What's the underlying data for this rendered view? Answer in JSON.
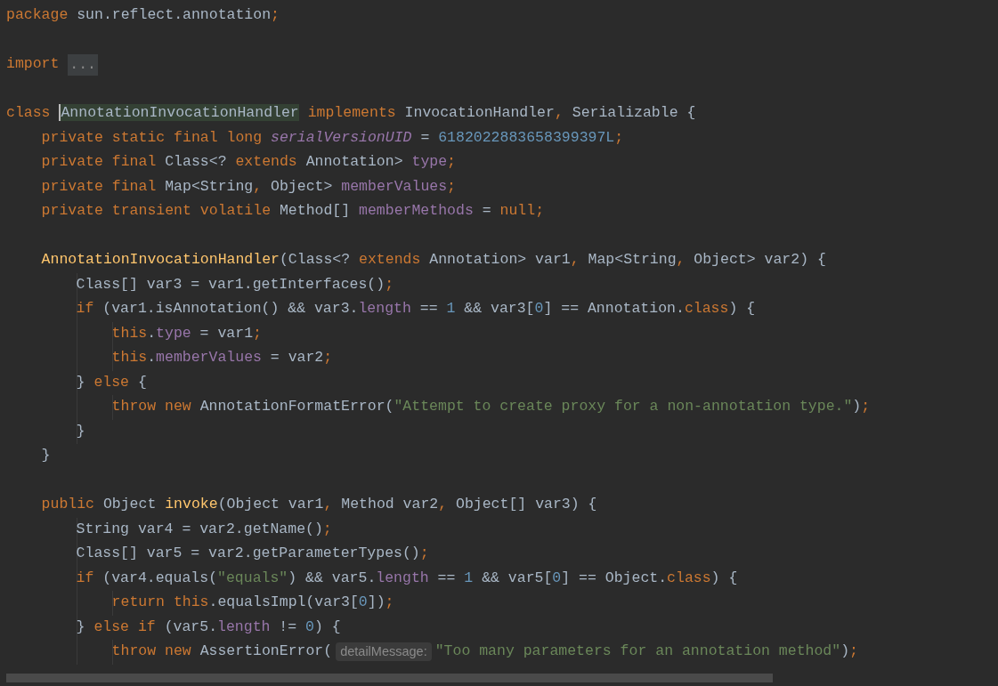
{
  "lines": [
    {
      "kind": "code",
      "tokens": [
        {
          "text": "package",
          "kind": "kw"
        },
        {
          "text": " sun.reflect.annotation",
          "kind": "plain"
        },
        {
          "text": ";",
          "kind": "kw"
        }
      ]
    },
    {
      "kind": "blank"
    },
    {
      "kind": "code",
      "tokens": [
        {
          "text": "import ",
          "kind": "kw"
        },
        {
          "text": "...",
          "kind": "fold"
        }
      ]
    },
    {
      "kind": "blank"
    },
    {
      "kind": "code",
      "tokens": [
        {
          "text": "class ",
          "kind": "kw"
        },
        {
          "text": "AnnotationInvocationHandler",
          "kind": "ref"
        },
        {
          "text": " implements ",
          "kind": "kw"
        },
        {
          "text": "InvocationHandler",
          "kind": "plain"
        },
        {
          "text": ",",
          "kind": "kw"
        },
        {
          "text": " Serializable {",
          "kind": "plain"
        }
      ],
      "children": [
        {
          "kind": "code",
          "tokens": [
            {
              "text": "private static final long ",
              "kind": "kw"
            },
            {
              "text": "serialVersionUID",
              "kind": "sfield"
            },
            {
              "text": " = ",
              "kind": "plain"
            },
            {
              "text": "6182022883658399397L",
              "kind": "num"
            },
            {
              "text": ";",
              "kind": "kw"
            }
          ]
        },
        {
          "kind": "code",
          "tokens": [
            {
              "text": "private final ",
              "kind": "kw"
            },
            {
              "text": "Class<? ",
              "kind": "plain"
            },
            {
              "text": "extends ",
              "kind": "kw"
            },
            {
              "text": "Annotation> ",
              "kind": "plain"
            },
            {
              "text": "type",
              "kind": "field"
            },
            {
              "text": ";",
              "kind": "kw"
            }
          ]
        },
        {
          "kind": "code",
          "tokens": [
            {
              "text": "private final ",
              "kind": "kw"
            },
            {
              "text": "Map<String",
              "kind": "plain"
            },
            {
              "text": ",",
              "kind": "kw"
            },
            {
              "text": " Object> ",
              "kind": "plain"
            },
            {
              "text": "memberValues",
              "kind": "field"
            },
            {
              "text": ";",
              "kind": "kw"
            }
          ]
        },
        {
          "kind": "code",
          "tokens": [
            {
              "text": "private transient volatile ",
              "kind": "kw"
            },
            {
              "text": "Method[] ",
              "kind": "plain"
            },
            {
              "text": "memberMethods",
              "kind": "field"
            },
            {
              "text": " = ",
              "kind": "plain"
            },
            {
              "text": "null",
              "kind": "kw"
            },
            {
              "text": ";",
              "kind": "kw"
            }
          ]
        },
        {
          "kind": "blank"
        },
        {
          "kind": "code",
          "tokens": [
            {
              "text": "AnnotationInvocationHandler",
              "kind": "decl"
            },
            {
              "text": "(Class<? ",
              "kind": "plain"
            },
            {
              "text": "extends ",
              "kind": "kw"
            },
            {
              "text": "Annotation> var1",
              "kind": "plain"
            },
            {
              "text": ",",
              "kind": "kw"
            },
            {
              "text": " Map<String",
              "kind": "plain"
            },
            {
              "text": ",",
              "kind": "kw"
            },
            {
              "text": " Object> var2) {",
              "kind": "plain"
            }
          ],
          "children": [
            {
              "kind": "code",
              "tokens": [
                {
                  "text": "Class[] var3 = var1.getInterfaces()",
                  "kind": "plain"
                },
                {
                  "text": ";",
                  "kind": "kw"
                }
              ]
            },
            {
              "kind": "code",
              "tokens": [
                {
                  "text": "if ",
                  "kind": "kw"
                },
                {
                  "text": "(var1.isAnnotation() && var3.",
                  "kind": "plain"
                },
                {
                  "text": "length",
                  "kind": "field"
                },
                {
                  "text": " == ",
                  "kind": "plain"
                },
                {
                  "text": "1",
                  "kind": "num"
                },
                {
                  "text": " && var3[",
                  "kind": "plain"
                },
                {
                  "text": "0",
                  "kind": "num"
                },
                {
                  "text": "] == Annotation.",
                  "kind": "plain"
                },
                {
                  "text": "class",
                  "kind": "kw"
                },
                {
                  "text": ") {",
                  "kind": "plain"
                }
              ],
              "children": [
                {
                  "kind": "code",
                  "tokens": [
                    {
                      "text": "this",
                      "kind": "kw"
                    },
                    {
                      "text": ".",
                      "kind": "plain"
                    },
                    {
                      "text": "type",
                      "kind": "field"
                    },
                    {
                      "text": " = var1",
                      "kind": "plain"
                    },
                    {
                      "text": ";",
                      "kind": "kw"
                    }
                  ]
                },
                {
                  "kind": "code",
                  "tokens": [
                    {
                      "text": "this",
                      "kind": "kw"
                    },
                    {
                      "text": ".",
                      "kind": "plain"
                    },
                    {
                      "text": "memberValues",
                      "kind": "field"
                    },
                    {
                      "text": " = var2",
                      "kind": "plain"
                    },
                    {
                      "text": ";",
                      "kind": "kw"
                    }
                  ]
                }
              ]
            },
            {
              "kind": "code",
              "tokens": [
                {
                  "text": "} ",
                  "kind": "plain"
                },
                {
                  "text": "else ",
                  "kind": "kw"
                },
                {
                  "text": "{",
                  "kind": "plain"
                }
              ],
              "children": [
                {
                  "kind": "code",
                  "tokens": [
                    {
                      "text": "throw new ",
                      "kind": "kw"
                    },
                    {
                      "text": "AnnotationFormatError(",
                      "kind": "plain"
                    },
                    {
                      "text": "\"Attempt to create proxy for a non-annotation type.\"",
                      "kind": "str"
                    },
                    {
                      "text": ")",
                      "kind": "plain"
                    },
                    {
                      "text": ";",
                      "kind": "kw"
                    }
                  ]
                }
              ]
            },
            {
              "kind": "code",
              "tokens": [
                {
                  "text": "}",
                  "kind": "plain"
                }
              ]
            }
          ]
        },
        {
          "kind": "code",
          "tokens": [
            {
              "text": "}",
              "kind": "plain"
            }
          ]
        },
        {
          "kind": "blank"
        },
        {
          "kind": "code",
          "tokens": [
            {
              "text": "public ",
              "kind": "kw"
            },
            {
              "text": "Object ",
              "kind": "plain"
            },
            {
              "text": "invoke",
              "kind": "decl"
            },
            {
              "text": "(Object var1",
              "kind": "plain"
            },
            {
              "text": ",",
              "kind": "kw"
            },
            {
              "text": " Method var2",
              "kind": "plain"
            },
            {
              "text": ",",
              "kind": "kw"
            },
            {
              "text": " Object[] var3) {",
              "kind": "plain"
            }
          ],
          "children": [
            {
              "kind": "code",
              "tokens": [
                {
                  "text": "String var4 = var2.getName()",
                  "kind": "plain"
                },
                {
                  "text": ";",
                  "kind": "kw"
                }
              ]
            },
            {
              "kind": "code",
              "tokens": [
                {
                  "text": "Class[] var5 = var2.getParameterTypes()",
                  "kind": "plain"
                },
                {
                  "text": ";",
                  "kind": "kw"
                }
              ]
            },
            {
              "kind": "code",
              "tokens": [
                {
                  "text": "if ",
                  "kind": "kw"
                },
                {
                  "text": "(var4.equals(",
                  "kind": "plain"
                },
                {
                  "text": "\"equals\"",
                  "kind": "str"
                },
                {
                  "text": ") && var5.",
                  "kind": "plain"
                },
                {
                  "text": "length",
                  "kind": "field"
                },
                {
                  "text": " == ",
                  "kind": "plain"
                },
                {
                  "text": "1",
                  "kind": "num"
                },
                {
                  "text": " && var5[",
                  "kind": "plain"
                },
                {
                  "text": "0",
                  "kind": "num"
                },
                {
                  "text": "] == Object.",
                  "kind": "plain"
                },
                {
                  "text": "class",
                  "kind": "kw"
                },
                {
                  "text": ") {",
                  "kind": "plain"
                }
              ],
              "children": [
                {
                  "kind": "code",
                  "tokens": [
                    {
                      "text": "return this",
                      "kind": "kw"
                    },
                    {
                      "text": ".equalsImpl(var3[",
                      "kind": "plain"
                    },
                    {
                      "text": "0",
                      "kind": "num"
                    },
                    {
                      "text": "])",
                      "kind": "plain"
                    },
                    {
                      "text": ";",
                      "kind": "kw"
                    }
                  ]
                }
              ]
            },
            {
              "kind": "code",
              "tokens": [
                {
                  "text": "} ",
                  "kind": "plain"
                },
                {
                  "text": "else if ",
                  "kind": "kw"
                },
                {
                  "text": "(var5.",
                  "kind": "plain"
                },
                {
                  "text": "length",
                  "kind": "field"
                },
                {
                  "text": " != ",
                  "kind": "plain"
                },
                {
                  "text": "0",
                  "kind": "num"
                },
                {
                  "text": ") {",
                  "kind": "plain"
                }
              ],
              "children": [
                {
                  "kind": "code",
                  "tokens": [
                    {
                      "text": "throw new ",
                      "kind": "kw"
                    },
                    {
                      "text": "AssertionError(",
                      "kind": "plain"
                    },
                    {
                      "text": "detailMessage:",
                      "kind": "hint"
                    },
                    {
                      "text": "\"Too many parameters for an annotation method\"",
                      "kind": "str"
                    },
                    {
                      "text": ")",
                      "kind": "plain"
                    },
                    {
                      "text": ";",
                      "kind": "kw"
                    }
                  ]
                }
              ]
            }
          ]
        }
      ]
    }
  ]
}
